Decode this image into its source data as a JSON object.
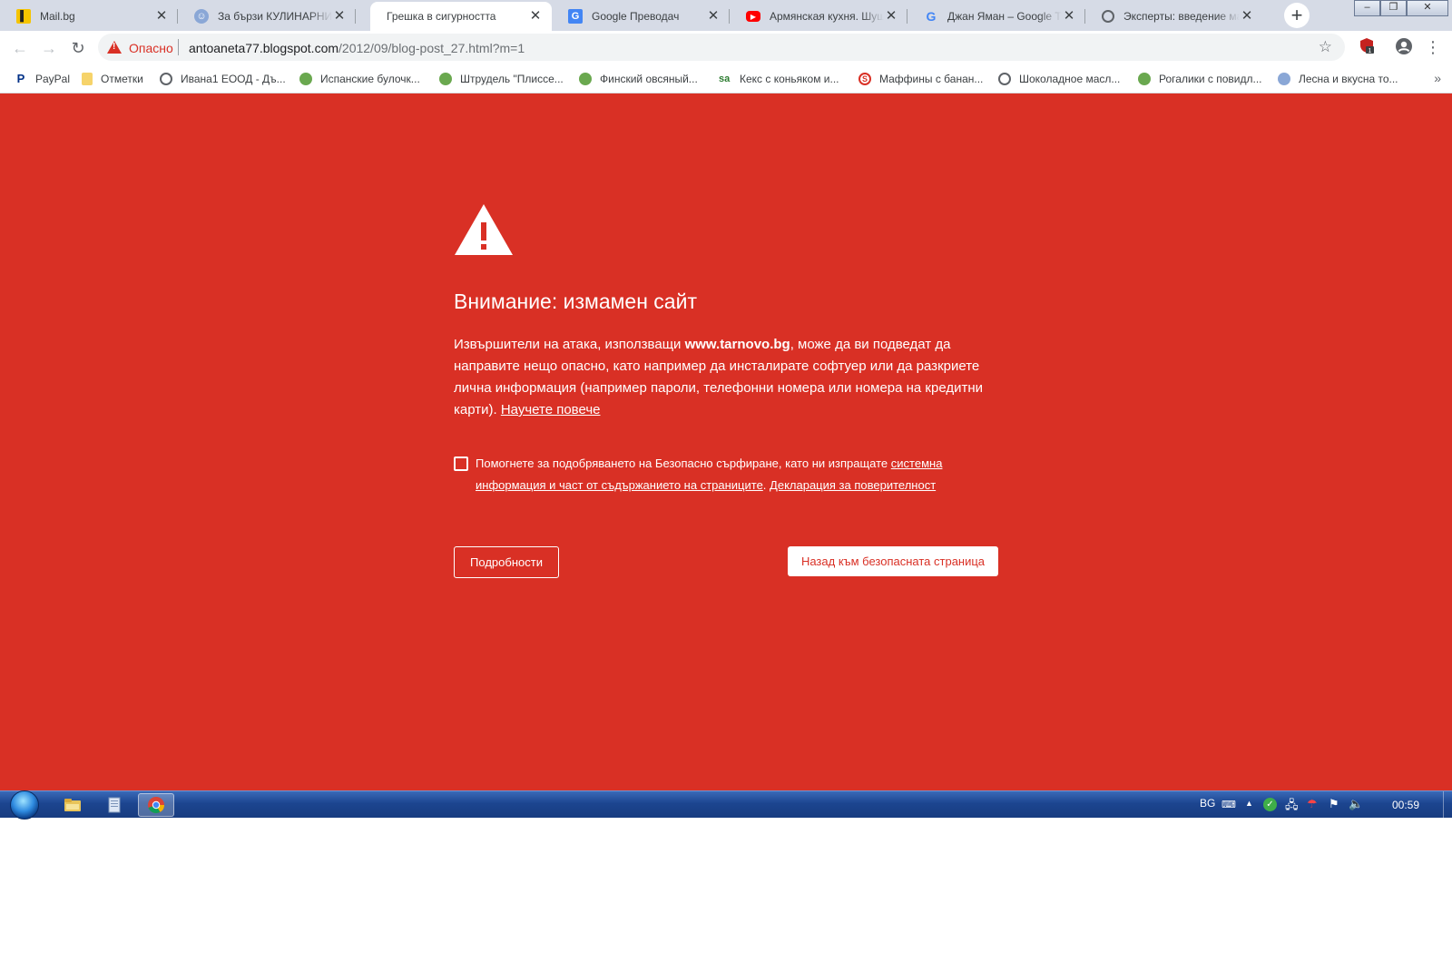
{
  "tabs": [
    {
      "title": "Mail.bg",
      "favicon": "mailbg-icon",
      "active": false
    },
    {
      "title": "За бързи КУЛИНАРНИ в",
      "favicon": "chef-hat-icon",
      "active": false
    },
    {
      "title": "Грешка в сигурността",
      "favicon": "none",
      "active": true
    },
    {
      "title": "Google Преводач",
      "favicon": "google-translate-icon",
      "active": false
    },
    {
      "title": "Армянская кухня. Шуша",
      "favicon": "youtube-icon",
      "active": false
    },
    {
      "title": "Джан Яман – Google Тър",
      "favicon": "google-icon",
      "active": false
    },
    {
      "title": "Эксперты: введение мас",
      "favicon": "globe-icon",
      "active": false
    }
  ],
  "toolbar": {
    "security_label": "Опасно",
    "url_host": "antoaneta77.blogspot.com",
    "url_path": "/2012/09/blog-post_27.html?m=1",
    "extension_badge": "1"
  },
  "bookmarks": [
    {
      "label": "PayPal",
      "icon": "paypal-icon"
    },
    {
      "label": "Отметки",
      "icon": "folder-icon"
    },
    {
      "label": "Ивана1 ЕООД - Дъ...",
      "icon": "globe-icon"
    },
    {
      "label": "Испанские булочк...",
      "icon": "leaf-icon"
    },
    {
      "label": "Штрудель \"Плиссе...",
      "icon": "leaf-icon"
    },
    {
      "label": "Финский овсяный...",
      "icon": "leaf-icon"
    },
    {
      "label": "Кекс с коньяком и...",
      "icon": "sa-icon"
    },
    {
      "label": "Маффины с банан...",
      "icon": "s-red-icon"
    },
    {
      "label": "Шоколадное масл...",
      "icon": "globe-icon"
    },
    {
      "label": "Рогалики с повидл...",
      "icon": "leaf-icon"
    },
    {
      "label": "Лесна и вкусна то...",
      "icon": "chef-hat-icon"
    }
  ],
  "interstitial": {
    "heading": "Внимание: измамен сайт",
    "text_before": "Извършители на атака, използващи ",
    "text_domain": "www.tarnovo.bg",
    "text_after": ", може да ви подведат да направите нещо опасно, като например да инсталирате софтуер или да разкриете лична информация (например пароли, телефонни номера или номера на кредитни карти). ",
    "learn_more": "Научете повече",
    "optin_text": "Помогнете за подобряването на Безопасно сърфиране, като ни изпращате ",
    "optin_link1": "системна информация и част от съдържанието на страниците",
    "optin_between": ". ",
    "optin_link2": "Декларация за поверителност",
    "details_button": "Подробности",
    "back_button": "Назад към безопасната страница",
    "background_color": "#d93025"
  },
  "taskbar": {
    "language": "BG",
    "clock": "00:59",
    "items": [
      "explorer-icon",
      "document-icon",
      "chrome-icon"
    ]
  }
}
